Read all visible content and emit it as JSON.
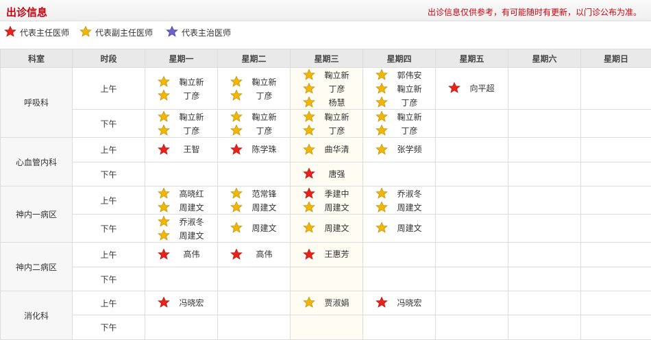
{
  "page": {
    "title": "出诊信息",
    "notice": "出诊信息仅供参考，有可能随时有更新，以门诊公布为准。"
  },
  "legend": [
    {
      "type": "red",
      "label": "代表主任医师"
    },
    {
      "type": "gold",
      "label": "代表副主任医师"
    },
    {
      "type": "purple",
      "label": "代表主治医师"
    }
  ],
  "colors": {
    "red": "#e8231b",
    "gold": "#f2b705",
    "purple": "#6a62c8",
    "accent": "#c8000b"
  },
  "table": {
    "headers": [
      "科室",
      "时段",
      "星期一",
      "星期二",
      "星期三",
      "星期四",
      "星期五",
      "星期六",
      "星期日"
    ],
    "departments": [
      {
        "name": "呼吸科",
        "periods": [
          {
            "label": "上午",
            "days": [
              [
                {
                  "n": "鞠立新",
                  "t": "gold"
                },
                {
                  "n": "丁彦",
                  "t": "gold"
                }
              ],
              [
                {
                  "n": "鞠立新",
                  "t": "gold"
                },
                {
                  "n": "丁彦",
                  "t": "gold"
                }
              ],
              [
                {
                  "n": "鞠立新",
                  "t": "gold"
                },
                {
                  "n": "丁彦",
                  "t": "gold"
                },
                {
                  "n": "杨慧",
                  "t": "gold"
                }
              ],
              [
                {
                  "n": "郭伟安",
                  "t": "gold"
                },
                {
                  "n": "鞠立新",
                  "t": "gold"
                },
                {
                  "n": "丁彦",
                  "t": "gold"
                }
              ],
              [
                {
                  "n": "向平超",
                  "t": "red"
                }
              ],
              [],
              []
            ]
          },
          {
            "label": "下午",
            "days": [
              [
                {
                  "n": "鞠立新",
                  "t": "gold"
                },
                {
                  "n": "丁彦",
                  "t": "gold"
                }
              ],
              [
                {
                  "n": "鞠立新",
                  "t": "gold"
                },
                {
                  "n": "丁彦",
                  "t": "gold"
                }
              ],
              [
                {
                  "n": "鞠立新",
                  "t": "gold"
                },
                {
                  "n": "丁彦",
                  "t": "gold"
                }
              ],
              [
                {
                  "n": "鞠立新",
                  "t": "gold"
                },
                {
                  "n": "丁彦",
                  "t": "gold"
                }
              ],
              [],
              [],
              []
            ]
          }
        ]
      },
      {
        "name": "心血管内科",
        "periods": [
          {
            "label": "上午",
            "days": [
              [
                {
                  "n": "王智",
                  "t": "red"
                }
              ],
              [
                {
                  "n": "陈学珠",
                  "t": "red"
                }
              ],
              [
                {
                  "n": "曲华清",
                  "t": "gold"
                }
              ],
              [
                {
                  "n": "张学频",
                  "t": "gold"
                }
              ],
              [],
              [],
              []
            ]
          },
          {
            "label": "下午",
            "days": [
              [],
              [],
              [
                {
                  "n": "唐强",
                  "t": "red"
                }
              ],
              [],
              [],
              [],
              []
            ]
          }
        ]
      },
      {
        "name": "神内一病区",
        "periods": [
          {
            "label": "上午",
            "days": [
              [
                {
                  "n": "高晓红",
                  "t": "gold"
                },
                {
                  "n": "周建文",
                  "t": "gold"
                }
              ],
              [
                {
                  "n": "范常锋",
                  "t": "gold"
                },
                {
                  "n": "周建文",
                  "t": "gold"
                }
              ],
              [
                {
                  "n": "季建中",
                  "t": "red"
                },
                {
                  "n": "周建文",
                  "t": "gold"
                }
              ],
              [
                {
                  "n": "乔淑冬",
                  "t": "gold"
                },
                {
                  "n": "周建文",
                  "t": "gold"
                }
              ],
              [],
              [],
              []
            ]
          },
          {
            "label": "下午",
            "days": [
              [
                {
                  "n": "乔淑冬",
                  "t": "gold"
                },
                {
                  "n": "周建文",
                  "t": "gold"
                }
              ],
              [
                {
                  "n": "周建文",
                  "t": "gold"
                }
              ],
              [
                {
                  "n": "周建文",
                  "t": "gold"
                }
              ],
              [
                {
                  "n": "周建文",
                  "t": "gold"
                }
              ],
              [],
              [],
              []
            ]
          }
        ]
      },
      {
        "name": "神内二病区",
        "periods": [
          {
            "label": "上午",
            "days": [
              [
                {
                  "n": "高伟",
                  "t": "red"
                }
              ],
              [
                {
                  "n": "高伟",
                  "t": "red"
                }
              ],
              [
                {
                  "n": "王惠芳",
                  "t": "red"
                }
              ],
              [],
              [],
              [],
              []
            ]
          },
          {
            "label": "下午",
            "days": [
              [],
              [],
              [],
              [],
              [],
              [],
              []
            ]
          }
        ]
      },
      {
        "name": "消化科",
        "periods": [
          {
            "label": "上午",
            "days": [
              [
                {
                  "n": "冯晓宏",
                  "t": "red"
                }
              ],
              [],
              [
                {
                  "n": "贾淑娟",
                  "t": "gold"
                }
              ],
              [
                {
                  "n": "冯晓宏",
                  "t": "red"
                }
              ],
              [],
              [],
              []
            ]
          },
          {
            "label": "下午",
            "days": [
              [],
              [],
              [],
              [],
              [],
              [],
              []
            ]
          }
        ]
      }
    ]
  }
}
